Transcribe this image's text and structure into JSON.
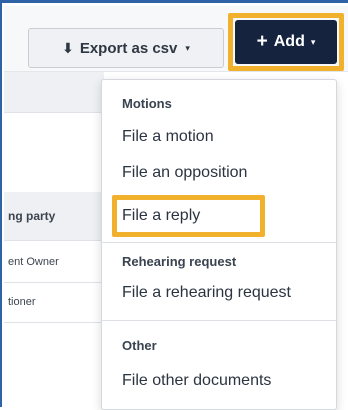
{
  "toolbar": {
    "export_icon": "download-icon",
    "export_label": "Export as csv",
    "export_caret": "▾",
    "add_plus": "+",
    "add_label": "Add",
    "add_caret": "▾"
  },
  "table": {
    "header_text": "ng party",
    "rows": [
      "ent Owner",
      "tioner"
    ]
  },
  "menu": {
    "sections": [
      {
        "heading": "Motions",
        "items": [
          "File a motion",
          "File an opposition",
          "File a reply"
        ]
      },
      {
        "heading": "Rehearing request",
        "items": [
          "File a rehearing request"
        ]
      },
      {
        "heading": "Other",
        "items": [
          "File other documents"
        ]
      }
    ]
  },
  "colors": {
    "highlight": "#f1b12c",
    "add_button_bg": "#15233f",
    "frame_border": "#2f63a8"
  }
}
